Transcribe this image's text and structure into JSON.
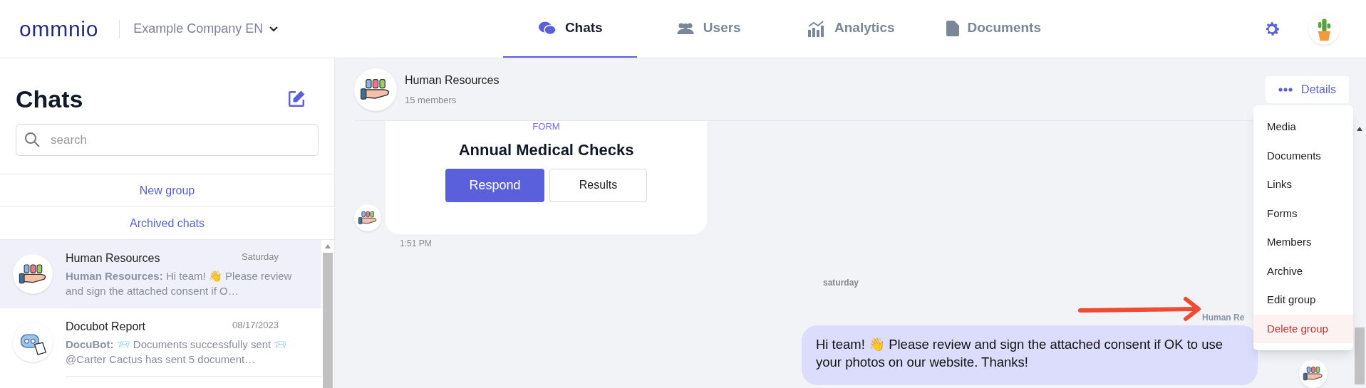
{
  "topbar": {
    "logo": "ommnio",
    "company": "Example Company EN",
    "tabs": [
      {
        "label": "Chats",
        "selected": true
      },
      {
        "label": "Users",
        "selected": false
      },
      {
        "label": "Analytics",
        "selected": false
      },
      {
        "label": "Documents",
        "selected": false
      }
    ]
  },
  "sidebar": {
    "title": "Chats",
    "search": {
      "placeholder": "search"
    },
    "links": [
      "New group",
      "Archived chats"
    ],
    "chats": [
      {
        "name": "Human Resources",
        "date": "Saturday",
        "sender": "Human Resources:",
        "preview": "Hi team! 👋 Please review and sign the attached consent if O…",
        "selected": true
      },
      {
        "name": "Docubot Report",
        "date": "08/17/2023",
        "sender": "DocuBot:",
        "preview": "📨 Documents successfully sent 📨 @Carter Cactus has sent 5 document…",
        "selected": false
      }
    ]
  },
  "conversation": {
    "name": "Human Resources",
    "members": "15 members",
    "details": "Details",
    "menu": [
      {
        "label": "Media",
        "danger": false,
        "highlighted": false
      },
      {
        "label": "Documents",
        "danger": false,
        "highlighted": false
      },
      {
        "label": "Links",
        "danger": false,
        "highlighted": false
      },
      {
        "label": "Forms",
        "danger": false,
        "highlighted": false
      },
      {
        "label": "Members",
        "danger": false,
        "highlighted": false
      },
      {
        "label": "Archive",
        "danger": false,
        "highlighted": false
      },
      {
        "label": "Edit group",
        "danger": false,
        "highlighted": false
      },
      {
        "label": "Delete group",
        "danger": true,
        "highlighted": true
      }
    ],
    "form": {
      "tag": "FORM",
      "title": "Annual Medical Checks",
      "respond": "Respond",
      "results": "Results",
      "time": "1:51 PM"
    },
    "day": "saturday",
    "message": {
      "sender": "Human Re",
      "text": "Hi team! 👋 Please review and sign the attached consent if OK to use your photos on our website. Thanks!"
    }
  }
}
